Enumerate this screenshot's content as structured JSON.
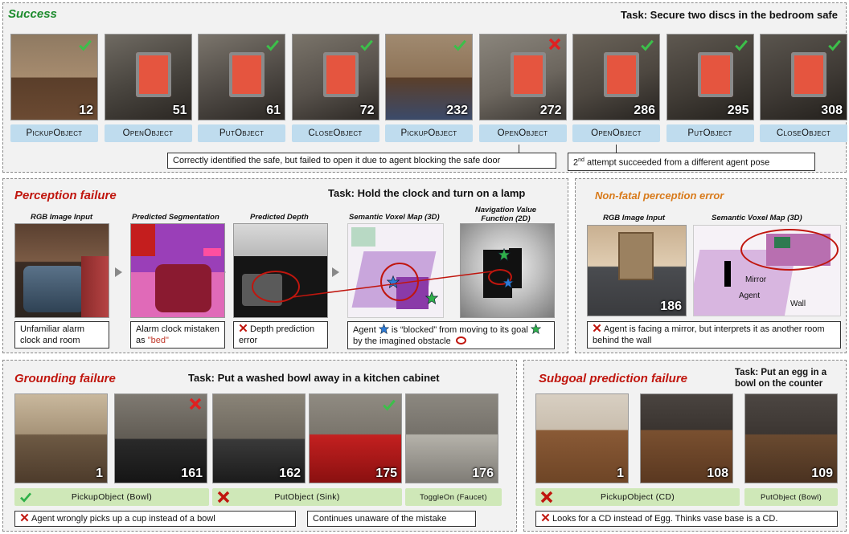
{
  "colors": {
    "success_title": "#1e8c2e",
    "failure_title": "#c0160e",
    "nonfatal_title": "#d87a1a",
    "action_blue": "#bfdcee",
    "action_green": "#cfe8b8",
    "highlight_red": "#c0392b"
  },
  "success": {
    "title": "Success",
    "task": "Task: Secure two discs in the bedroom safe",
    "frames": [
      {
        "num": "12",
        "status": "check"
      },
      {
        "num": "51",
        "status": "none"
      },
      {
        "num": "61",
        "status": "check"
      },
      {
        "num": "72",
        "status": "check"
      },
      {
        "num": "232",
        "status": "check"
      },
      {
        "num": "272",
        "status": "x"
      },
      {
        "num": "286",
        "status": "check"
      },
      {
        "num": "295",
        "status": "check"
      },
      {
        "num": "308",
        "status": "check"
      }
    ],
    "actions": [
      "PickupObject",
      "OpenObject",
      "PutObject",
      "CloseObject",
      "PickupObject",
      "OpenObject",
      "OpenObject",
      "PutObject",
      "CloseObject"
    ],
    "note1": "Correctly identified the safe, but failed to open it due to agent blocking the safe door",
    "note2_sup": "nd",
    "note2_num": "2",
    "note2_text": " attempt succeeded from a different agent pose"
  },
  "perception": {
    "title": "Perception failure",
    "task": "Task: Hold the clock and turn on a lamp",
    "captions": [
      "RGB Image Input",
      "Predicted Segmentation",
      "Predicted Depth",
      "Semantic Voxel Map (3D)",
      "Navigation Value Function (2D)"
    ],
    "note1": "Unfamiliar alarm clock and room",
    "note2_a": "Alarm clock mistaken as ",
    "note2_b": "\"bed\"",
    "note3": "Depth prediction error",
    "note4_a": "Agent",
    "note4_b": " is “blocked” from moving to its goal",
    "note4_c": " by the imagined obstacle"
  },
  "nonfatal": {
    "title": "Non-fatal perception error",
    "captions": [
      "RGB Image Input",
      "Semantic Voxel Map (3D)"
    ],
    "frame_num": "186",
    "labels": [
      "Mirror",
      "Agent",
      "Wall"
    ],
    "note": "Agent is facing a mirror, but interprets it as another room behind the wall"
  },
  "grounding": {
    "title": "Grounding failure",
    "task": "Task: Put a washed bowl away in a kitchen cabinet",
    "frames": [
      {
        "num": "1",
        "status": "none"
      },
      {
        "num": "161",
        "status": "x"
      },
      {
        "num": "162",
        "status": "none"
      },
      {
        "num": "175",
        "status": "check"
      },
      {
        "num": "176",
        "status": "none"
      }
    ],
    "actions": [
      "PickupObject (Bowl)",
      "PutObject (Sink)",
      "ToggleOn (Faucet)"
    ],
    "note1": "Agent wrongly picks up a cup instead of a bowl",
    "note2": "Continues unaware of the mistake"
  },
  "subgoal": {
    "title": "Subgoal prediction failure",
    "task_line1": "Task: Put an egg in a",
    "task_line2": "bowl on the counter",
    "frames": [
      {
        "num": "1"
      },
      {
        "num": "108"
      },
      {
        "num": "109"
      }
    ],
    "actions": [
      "PickupObject (CD)",
      "PutObject (Bowl)"
    ],
    "note": "Looks for a CD instead of Egg. Thinks vase base is a CD."
  }
}
